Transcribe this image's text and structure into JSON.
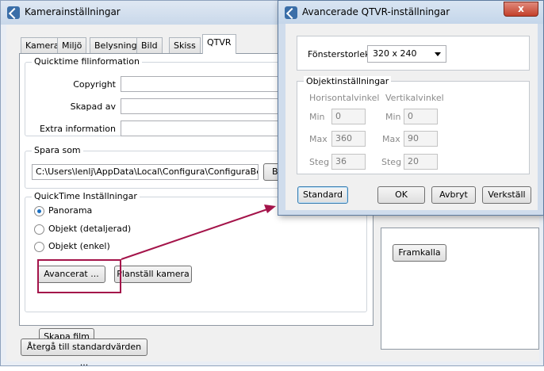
{
  "main_window": {
    "title": "Kamerainställningar",
    "tabs": [
      {
        "label": "Kamera",
        "active": false
      },
      {
        "label": "Miljö",
        "active": false
      },
      {
        "label": "Belysning",
        "active": false
      },
      {
        "label": "Bild",
        "active": false
      },
      {
        "label": "Skiss",
        "active": false
      },
      {
        "label": "QTVR",
        "active": true
      }
    ],
    "quicktime_info": {
      "legend": "Quicktime filinformation",
      "fields": [
        {
          "label": "Copyright",
          "value": ""
        },
        {
          "label": "Skapad av",
          "value": ""
        },
        {
          "label": "Extra information",
          "value": ""
        }
      ]
    },
    "save_as": {
      "legend": "Spara som",
      "path": "C:\\Users\\lenlj\\AppData\\Local\\Configura\\ConfiguraBeta",
      "browse_label": "Bl"
    },
    "quicktime_settings": {
      "legend": "QuickTime Inställningar",
      "options": [
        {
          "label": "Panorama",
          "checked": true
        },
        {
          "label": "Objekt (detaljerad)",
          "checked": false
        },
        {
          "label": "Objekt (enkel)",
          "checked": false
        }
      ],
      "advanced_button": "Avancerat ...",
      "level_camera_button": "Planställ kamera"
    },
    "create_movie_button": "Skapa film",
    "reset_button": "Återgå till standardvärden ...",
    "render_button": "Framkalla"
  },
  "dialog": {
    "title": "Avancerade QTVR-inställningar",
    "close_label": "x",
    "window_size": {
      "label": "Fönsterstorlek",
      "value": "320 x 240"
    },
    "object_settings": {
      "legend": "Objektinställningar",
      "horizontal_header": "Horisontalvinkel",
      "vertical_header": "Vertikalvinkel",
      "rows": [
        {
          "label": "Min",
          "h": "0",
          "v": "0"
        },
        {
          "label": "Max",
          "h": "360",
          "v": "90"
        },
        {
          "label": "Steg",
          "h": "36",
          "v": "20"
        }
      ]
    },
    "buttons": {
      "standard": "Standard",
      "ok": "OK",
      "cancel": "Avbryt",
      "apply": "Verkställ"
    }
  },
  "colors": {
    "highlight": "#a4144a",
    "accent": "#1a6fc2"
  }
}
